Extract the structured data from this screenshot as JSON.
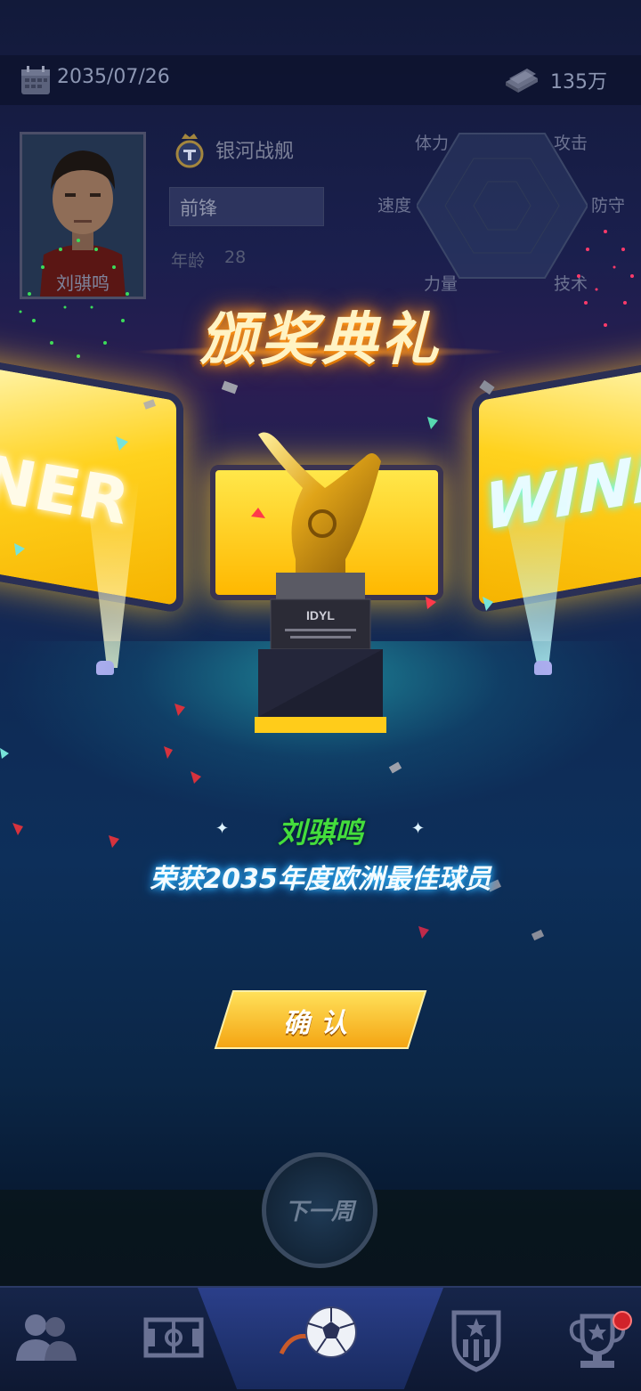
{
  "top_bar": {
    "date": "2035/07/26",
    "money": "135万"
  },
  "player": {
    "name": "刘骐鸣",
    "club": "银河战舰",
    "position": "前锋",
    "age_label": "年龄",
    "age": "28"
  },
  "radar": {
    "labels": {
      "stamina": "体力",
      "attack": "攻击",
      "speed": "速度",
      "defense": "防守",
      "power": "力量",
      "technique": "技术"
    }
  },
  "ceremony": {
    "title": "颁奖典礼",
    "screen_left_text": "NER",
    "screen_right_text": "WINN",
    "trophy_plate": "IDYL",
    "winner_name": "刘骐鸣",
    "award_text": "荣获2035年度欧洲最佳球员",
    "confirm_label": "确认"
  },
  "next_week_label": "下一周",
  "nav": [
    {
      "icon": "team-icon"
    },
    {
      "icon": "pitch-icon"
    },
    {
      "icon": "match-ball-icon",
      "active": true
    },
    {
      "icon": "club-crest-icon"
    },
    {
      "icon": "trophy-room-icon",
      "badge": true
    }
  ],
  "colors": {
    "accent_gold": "#ffc21e",
    "winner_green": "#44dd3c",
    "award_glow": "#37c6ff"
  }
}
